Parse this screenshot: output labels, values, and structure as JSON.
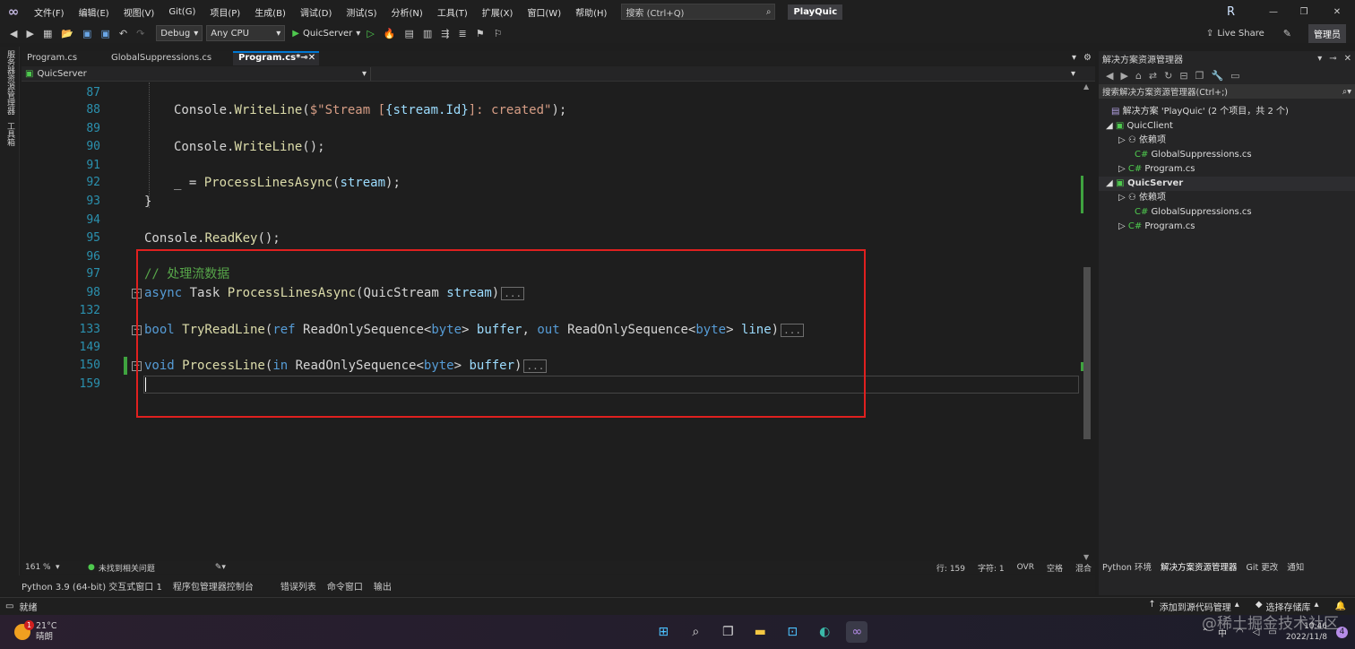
{
  "menu": {
    "items": [
      "文件(F)",
      "编辑(E)",
      "视图(V)",
      "Git(G)",
      "项目(P)",
      "生成(B)",
      "调试(D)",
      "测试(S)",
      "分析(N)",
      "工具(T)",
      "扩展(X)",
      "窗口(W)",
      "帮助(H)"
    ],
    "search_placeholder": "搜索 (Ctrl+Q)",
    "project_badge": "PlayQuic",
    "user_initial": "R"
  },
  "toolbar": {
    "config": "Debug",
    "platform": "Any CPU",
    "run_target": "QuicServer",
    "live_share": "Live Share",
    "admin": "管理员"
  },
  "left_strip": {
    "item1": "服务器资源管理器",
    "item2": "工具箱"
  },
  "tabs": [
    {
      "label": "Program.cs"
    },
    {
      "label": "GlobalSuppressions.cs"
    },
    {
      "label": "Program.cs*"
    }
  ],
  "navbar": {
    "project": "QuicServer"
  },
  "code_lines": [
    {
      "ln": "87"
    },
    {
      "ln": "88"
    },
    {
      "ln": "89"
    },
    {
      "ln": "90"
    },
    {
      "ln": "91"
    },
    {
      "ln": "92"
    },
    {
      "ln": "93"
    },
    {
      "ln": "94"
    },
    {
      "ln": "95"
    },
    {
      "ln": "96"
    },
    {
      "ln": "97"
    },
    {
      "ln": "98"
    },
    {
      "ln": "132"
    },
    {
      "ln": "133"
    },
    {
      "ln": "149"
    },
    {
      "ln": "150"
    },
    {
      "ln": "159"
    }
  ],
  "code": {
    "l88_a": "Console.",
    "l88_b": "WriteLine",
    "l88_c": "(",
    "l88_d": "$\"Stream [",
    "l88_e": "{stream.Id}",
    "l88_f": "]: created\"",
    "l88_g": ");",
    "l90_a": "Console.",
    "l90_b": "WriteLine",
    "l90_c": "();",
    "l92_a": "_ = ",
    "l92_b": "ProcessLinesAsync",
    "l92_c": "(",
    "l92_d": "stream",
    "l92_e": ");",
    "l93": "}",
    "l95_a": "Console.",
    "l95_b": "ReadKey",
    "l95_c": "();",
    "l97": "// 处理流数据",
    "l98_kw": "async",
    "l98_ty": " Task ",
    "l98_fn": "ProcessLinesAsync",
    "l98_p1": "(QuicStream ",
    "l98_p2": "stream",
    "l98_p3": ")",
    "l133_kw": "bool",
    "l133_fn": " TryReadLine",
    "l133_a": "(",
    "l133_ref": "ref",
    "l133_b": " ReadOnlySequence<",
    "l133_byte": "byte",
    "l133_c": "> ",
    "l133_buf": "buffer",
    "l133_d": ", ",
    "l133_out": "out",
    "l133_e": " ReadOnlySequence<",
    "l133_byte2": "byte",
    "l133_f": "> ",
    "l133_line": "line",
    "l133_g": ")",
    "l150_kw": "void",
    "l150_fn": " ProcessLine",
    "l150_a": "(",
    "l150_in": "in",
    "l150_b": " ReadOnlySequence<",
    "l150_byte": "byte",
    "l150_c": "> ",
    "l150_buf": "buffer",
    "l150_d": ")",
    "collapsed": "..."
  },
  "solution_explorer": {
    "title": "解决方案资源管理器",
    "search_placeholder": "搜索解决方案资源管理器(Ctrl+;)",
    "solution": "解决方案 'PlayQuic' (2 个项目，共 2 个)",
    "items": [
      {
        "label": "QuicClient"
      },
      {
        "label": "依赖项"
      },
      {
        "label": "GlobalSuppressions.cs"
      },
      {
        "label": "Program.cs"
      },
      {
        "label": "QuicServer"
      },
      {
        "label": "依赖项"
      },
      {
        "label": "GlobalSuppressions.cs"
      },
      {
        "label": "Program.cs"
      }
    ],
    "bottom_tabs": [
      "Python 环境",
      "解决方案资源管理器",
      "Git 更改",
      "通知"
    ]
  },
  "status": {
    "zoom": "161 %",
    "issues": "未找到相关问题",
    "row": "行: 159",
    "col": "字符: 1",
    "ovr": "OVR",
    "space": "空格",
    "mixed": "混合"
  },
  "bottom_panels": [
    "Python 3.9 (64-bit) 交互式窗口 1",
    "程序包管理器控制台",
    "错误列表",
    "命令窗口",
    "输出"
  ],
  "ready": {
    "label": "就绪",
    "add_source": "添加到源代码管理",
    "select_repo": "选择存储库"
  },
  "taskbar": {
    "temp": "21°C",
    "weather": "晴朗",
    "weather_badge": "1",
    "time": "10:46",
    "date": "2022/11/8",
    "lang": "中",
    "watermark": "@稀土掘金技术社区",
    "notif": "4"
  },
  "colors": {
    "accent": "#0078d4",
    "highlight_box": "#e0201f",
    "vs_purple": "#68217a"
  }
}
